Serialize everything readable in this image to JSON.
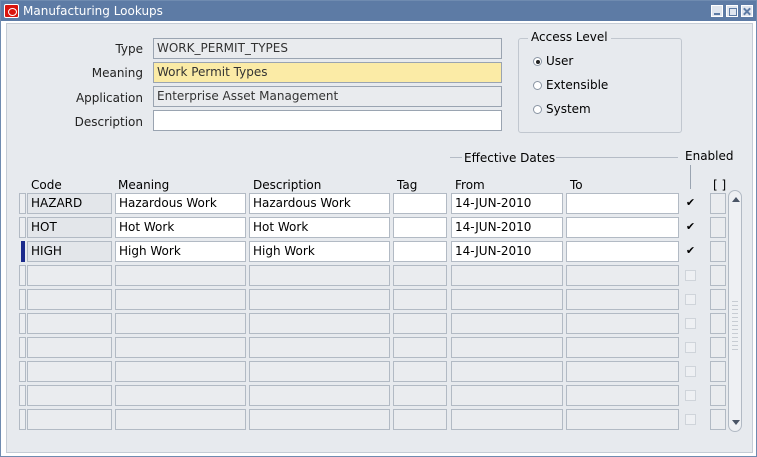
{
  "window": {
    "title": "Manufacturing Lookups"
  },
  "header": {
    "type_label": "Type",
    "type_value": "WORK_PERMIT_TYPES",
    "meaning_label": "Meaning",
    "meaning_value": "Work Permit Types",
    "application_label": "Application",
    "application_value": "Enterprise Asset Management",
    "description_label": "Description",
    "description_value": ""
  },
  "access_level": {
    "title": "Access Level",
    "options": [
      {
        "label": "User",
        "selected": true
      },
      {
        "label": "Extensible",
        "selected": false
      },
      {
        "label": "System",
        "selected": false
      }
    ]
  },
  "grid": {
    "effective_dates_label": "Effective Dates",
    "enabled_label": "Enabled",
    "df_label": "[ ]",
    "columns": {
      "code": "Code",
      "meaning": "Meaning",
      "description": "Description",
      "tag": "Tag",
      "from": "From",
      "to": "To"
    },
    "rows": [
      {
        "code": "HAZARD",
        "meaning": "Hazardous Work",
        "description": "Hazardous Work",
        "tag": "",
        "from": "14-JUN-2010",
        "to": "",
        "enabled": true
      },
      {
        "code": "HOT",
        "meaning": "Hot Work",
        "description": "Hot Work",
        "tag": "",
        "from": "14-JUN-2010",
        "to": "",
        "enabled": true
      },
      {
        "code": "HIGH",
        "meaning": "High Work",
        "description": "High Work",
        "tag": "",
        "from": "14-JUN-2010",
        "to": "",
        "enabled": true
      },
      {
        "code": "",
        "meaning": "",
        "description": "",
        "tag": "",
        "from": "",
        "to": "",
        "enabled": false
      },
      {
        "code": "",
        "meaning": "",
        "description": "",
        "tag": "",
        "from": "",
        "to": "",
        "enabled": false
      },
      {
        "code": "",
        "meaning": "",
        "description": "",
        "tag": "",
        "from": "",
        "to": "",
        "enabled": false
      },
      {
        "code": "",
        "meaning": "",
        "description": "",
        "tag": "",
        "from": "",
        "to": "",
        "enabled": false
      },
      {
        "code": "",
        "meaning": "",
        "description": "",
        "tag": "",
        "from": "",
        "to": "",
        "enabled": false
      },
      {
        "code": "",
        "meaning": "",
        "description": "",
        "tag": "",
        "from": "",
        "to": "",
        "enabled": false
      },
      {
        "code": "",
        "meaning": "",
        "description": "",
        "tag": "",
        "from": "",
        "to": "",
        "enabled": false
      }
    ]
  }
}
